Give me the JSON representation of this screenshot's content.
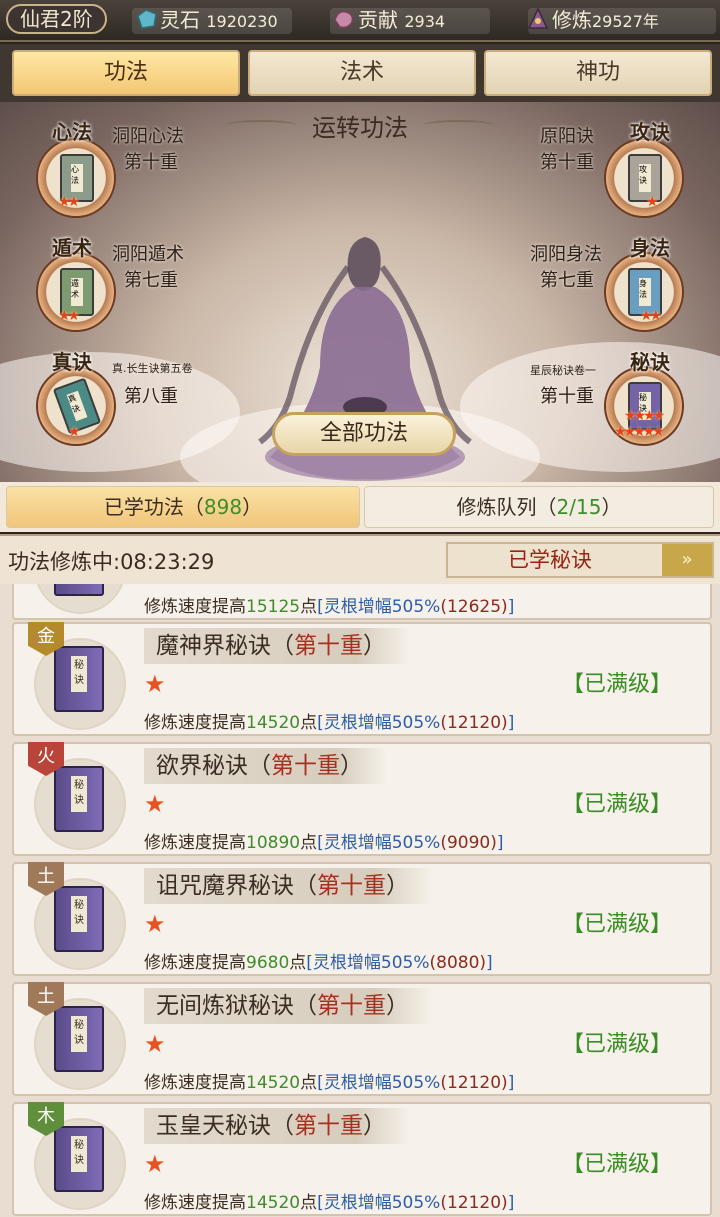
{
  "topbar": {
    "rank": "仙君2阶",
    "resources": [
      {
        "icon": "spirit-stone-icon",
        "label": "灵石",
        "value": "1920230"
      },
      {
        "icon": "contribution-icon",
        "label": "贡献",
        "value": "2934"
      },
      {
        "icon": "cultivation-icon",
        "label": "修炼",
        "value": "29527年"
      }
    ]
  },
  "tabs": [
    "功法",
    "法术",
    "神功"
  ],
  "stage": {
    "title": "运转功法",
    "slots": [
      {
        "tag": "心法",
        "name": "洞阳心法",
        "level": "第十重",
        "book_text": "心法"
      },
      {
        "tag": "遁术",
        "name": "洞阳遁术",
        "level": "第七重",
        "book_text": "遁术"
      },
      {
        "tag": "真诀",
        "name": "真.长生诀第五卷",
        "level": "第八重",
        "book_text": "真诀"
      },
      {
        "tag": "攻诀",
        "name": "原阳诀",
        "level": "第十重",
        "book_text": "攻诀"
      },
      {
        "tag": "身法",
        "name": "洞阳身法",
        "level": "第七重",
        "book_text": "身法"
      },
      {
        "tag": "秘诀",
        "name": "星辰秘诀卷一",
        "level": "第十重",
        "book_text": "秘诀"
      }
    ],
    "all_button": "全部功法"
  },
  "subtabs": {
    "learned_label": "已学功法（",
    "learned_count": "898",
    "learned_close": "）",
    "queue_label": "修炼队列（",
    "queue_count": "2/15",
    "queue_close": "）"
  },
  "status": {
    "timer": "功法修炼中:08:23:29",
    "dropdown": "已学秘诀",
    "dropdown_arrow": "»"
  },
  "list": {
    "partial_desc": {
      "prefix": "修炼速度提高",
      "value": "15125",
      "unit": "点",
      "bracket": "[灵根增幅505%",
      "extra": "(12625)",
      "end": "]"
    },
    "cards": [
      {
        "element": "金",
        "element_color": "#b58a2a",
        "name": "魔神界秘诀（",
        "level": "第十重",
        "close": "）",
        "status": "【已满级】",
        "desc": {
          "prefix": "修炼速度提高",
          "value": "14520",
          "unit": "点",
          "bracket": "[灵根增幅505%",
          "extra": "(12120)",
          "end": "]"
        }
      },
      {
        "element": "火",
        "element_color": "#b8443a",
        "name": "欲界秘诀（",
        "level": "第十重",
        "close": "）",
        "status": "【已满级】",
        "desc": {
          "prefix": "修炼速度提高",
          "value": "10890",
          "unit": "点",
          "bracket": "[灵根增幅505%",
          "extra": "(9090)",
          "end": "]"
        }
      },
      {
        "element": "土",
        "element_color": "#a07a58",
        "name": "诅咒魔界秘诀（",
        "level": "第十重",
        "close": "）",
        "status": "【已满级】",
        "desc": {
          "prefix": "修炼速度提高",
          "value": "9680",
          "unit": "点",
          "bracket": "[灵根增幅505%",
          "extra": "(8080)",
          "end": "]"
        }
      },
      {
        "element": "土",
        "element_color": "#a07a58",
        "name": "无间炼狱秘诀（",
        "level": "第十重",
        "close": "）",
        "status": "【已满级】",
        "desc": {
          "prefix": "修炼速度提高",
          "value": "14520",
          "unit": "点",
          "bracket": "[灵根增幅505%",
          "extra": "(12120)",
          "end": "]"
        }
      },
      {
        "element": "木",
        "element_color": "#5f8f3a",
        "name": "玉皇天秘诀（",
        "level": "第十重",
        "close": "）",
        "status": "【已满级】",
        "desc": {
          "prefix": "修炼速度提高",
          "value": "14520",
          "unit": "点",
          "bracket": "[灵根增幅505%",
          "extra": "(12120)",
          "end": "]"
        }
      }
    ]
  }
}
